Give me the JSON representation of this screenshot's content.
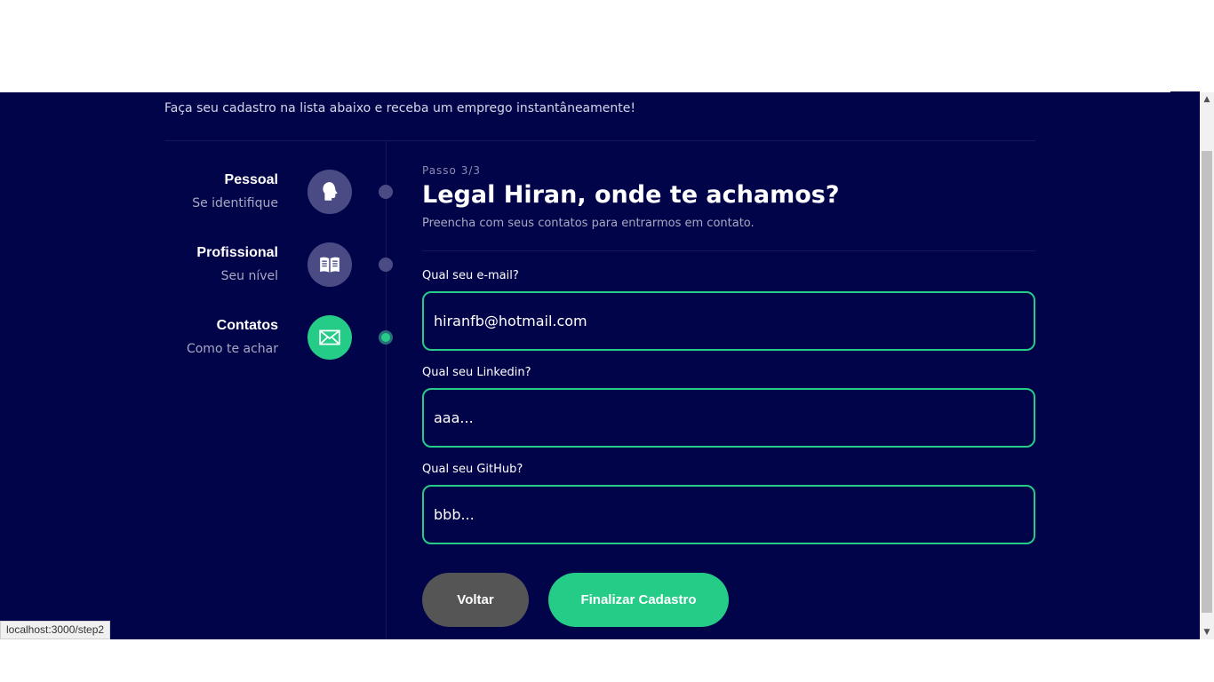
{
  "header": {
    "subtitle": "Faça seu cadastro na lista abaixo e receba um emprego instantâneamente!"
  },
  "steps": [
    {
      "title": "Pessoal",
      "subtitle": "Se identifique",
      "icon": "head-icon",
      "active": false
    },
    {
      "title": "Profissional",
      "subtitle": "Seu nível",
      "icon": "book-icon",
      "active": false
    },
    {
      "title": "Contatos",
      "subtitle": "Como te achar",
      "icon": "mail-icon",
      "active": true
    }
  ],
  "form": {
    "step_indicator": "Passo 3/3",
    "heading": "Legal Hiran, onde te achamos?",
    "description": "Preencha com seus contatos para entrarmos em contato.",
    "fields": [
      {
        "label": "Qual seu e-mail?",
        "value": "hiranfb@hotmail.com"
      },
      {
        "label": "Qual seu Linkedin?",
        "value": "aaa..."
      },
      {
        "label": "Qual seu GitHub?",
        "value": "bbb..."
      }
    ],
    "back_label": "Voltar",
    "finish_label": "Finalizar Cadastro"
  },
  "status_url": "localhost:3000/step2",
  "colors": {
    "background": "#02044a",
    "accent": "#25cc87",
    "inactive": "#4a4a85",
    "back_button": "#555555"
  }
}
